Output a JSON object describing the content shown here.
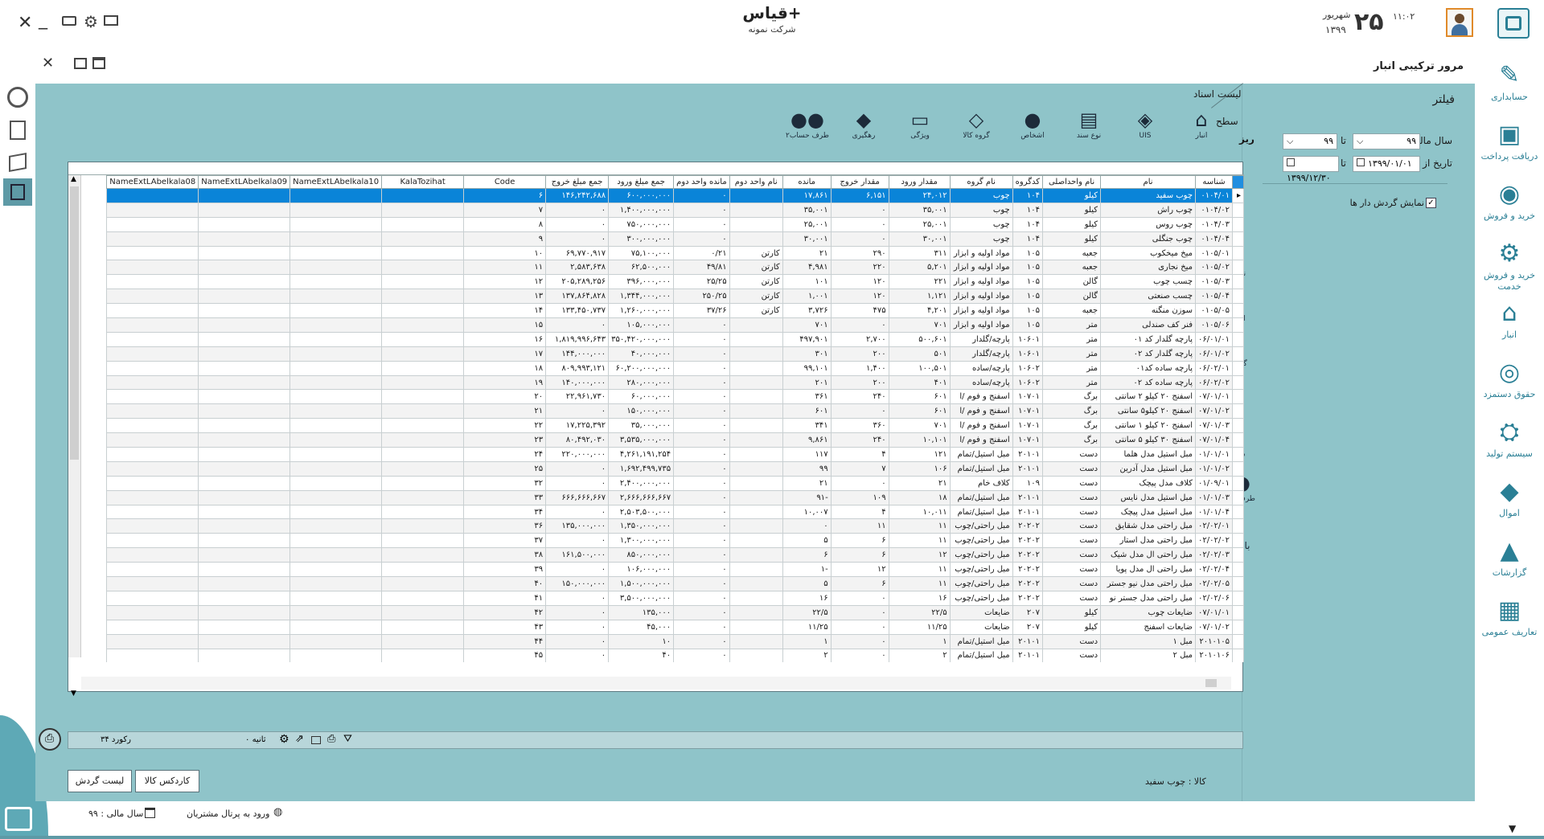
{
  "header": {
    "app_title": "قیاس+",
    "company": "شرکت نمونه",
    "time": "۱۱:۰۲",
    "day": "۲۵",
    "month": "شهریور",
    "year": "۱۳۹۹"
  },
  "window_controls": [
    "close-icon",
    "minimize-icon",
    "keyboard-icon",
    "gear-icon",
    "monitor-icon"
  ],
  "page_title": "مرور ترکیبی انبار",
  "nav": [
    {
      "label": "حسابداری",
      "icon": "accounting-icon"
    },
    {
      "label": "دریافت پرداخت",
      "icon": "payment-icon"
    },
    {
      "label": "خرید و فروش",
      "icon": "cart-icon"
    },
    {
      "label": "خرید و فروش خدمت",
      "icon": "service-gear-icon"
    },
    {
      "label": "انبار",
      "icon": "warehouse-icon"
    },
    {
      "label": "حقوق دستمزد",
      "icon": "coins-icon"
    },
    {
      "label": "سیستم تولید",
      "icon": "production-icon"
    },
    {
      "label": "اموال",
      "icon": "box-icon"
    },
    {
      "label": "گزارشات",
      "icon": "chart-icon"
    },
    {
      "label": "تعاریف عمومی",
      "icon": "table-icon"
    }
  ],
  "filter": {
    "title": "فیلتر",
    "fiscal_from_label": "سال مالی از",
    "fiscal_from": "۹۹",
    "to_label": "تا",
    "fiscal_to": "۹۹",
    "date_from_label": "تاریخ از",
    "date_from": "۱۳۹۹/۰۱/۰۱",
    "date_to": "۱۳۹۹/۱۲/۳۰",
    "show_active_label": "نمایش گردش دار ها"
  },
  "docs_list_title": "لیست اسناد",
  "level": {
    "top": "سطح",
    "sub": "ریز"
  },
  "toolbar": [
    {
      "label": "انبار",
      "icon": "warehouse-icon"
    },
    {
      "label": "UIS",
      "icon": "cube-icon"
    },
    {
      "label": "نوع سند",
      "icon": "doc-type-icon"
    },
    {
      "label": "اشخاص",
      "icon": "person-icon"
    },
    {
      "label": "گروه کالا",
      "icon": "group-icon"
    },
    {
      "label": "ویژگی",
      "icon": "feature-icon"
    },
    {
      "label": "رهگیری",
      "icon": "tag-icon"
    },
    {
      "label": "طرف حساب۲",
      "icon": "people-icon"
    }
  ],
  "side_tools": [
    {
      "label": "انبار",
      "icon": "warehouse-icon"
    },
    {
      "label": "UIS",
      "icon": "cube-icon"
    },
    {
      "label": "نوع سند",
      "icon": "doc-type-icon"
    },
    {
      "label": "اشخاص",
      "icon": "person-icon"
    },
    {
      "label": "گروه کالا",
      "icon": "group-icon"
    },
    {
      "label": "ویژگی",
      "icon": "feature-icon"
    },
    {
      "label": "رهگیری",
      "icon": "tag-icon"
    },
    {
      "label": "طرف حساب۲",
      "icon": "people-icon"
    },
    {
      "label": "بازگشت",
      "icon": "back-icon"
    }
  ],
  "columns": [
    "شناسه",
    "نام",
    "نام واحداصلی",
    "کدگروه",
    "نام گروه",
    "مقدار ورود",
    "مقدار خروج",
    "مانده",
    "نام واحد دوم",
    "مانده واحد دوم",
    "جمع مبلغ ورود",
    "جمع مبلغ خروج",
    "Code",
    "KalaTozihat",
    "NameExtLAbelkala10",
    "NameExtLAbelkala09",
    "NameExtLAbelkala08"
  ],
  "rows": [
    [
      "۰۱۰۴/۰۱",
      "چوب سفید",
      "کیلو",
      "۱۰۴",
      "چوب",
      "۲۴,۰۱۲",
      "۶,۱۵۱",
      "۱۷,۸۶۱",
      "",
      "۰",
      "۶۰۰,۰۰۰,۰۰۰",
      "۱۴۶,۲۴۲,۶۸۸",
      "۶",
      "",
      "",
      "",
      ""
    ],
    [
      "۰۱۰۴/۰۲",
      "چوب راش",
      "کیلو",
      "۱۰۴",
      "چوب",
      "۳۵,۰۰۱",
      "۰",
      "۳۵,۰۰۱",
      "",
      "۰",
      "۱,۴۰۰,۰۰۰,۰۰۰",
      "۰",
      "۷",
      "",
      "",
      "",
      ""
    ],
    [
      "۰۱۰۴/۰۳",
      "چوب روس",
      "کیلو",
      "۱۰۴",
      "چوب",
      "۲۵,۰۰۱",
      "۰",
      "۲۵,۰۰۱",
      "",
      "۰",
      "۷۵۰,۰۰۰,۰۰۰",
      "۰",
      "۸",
      "",
      "",
      "",
      ""
    ],
    [
      "۰۱۰۴/۰۴",
      "چوب جنگلی",
      "کیلو",
      "۱۰۴",
      "چوب",
      "۳۰,۰۰۱",
      "۰",
      "۳۰,۰۰۱",
      "",
      "۰",
      "۳۰۰,۰۰۰,۰۰۰",
      "۰",
      "۹",
      "",
      "",
      "",
      ""
    ],
    [
      "۰۱۰۵/۰۱",
      "میخ میخکوب",
      "جعبه",
      "۱۰۵",
      "مواد اولیه و ابزار",
      "۳۱۱",
      "۲۹۰",
      "۲۱",
      "کارتن",
      "۰/۲۱",
      "۷۵,۱۰۰,۰۰۰",
      "۶۹,۷۷۰,۹۱۷",
      "۱۰",
      "",
      "",
      "",
      ""
    ],
    [
      "۰۱۰۵/۰۲",
      "میخ نجاری",
      "جعبه",
      "۱۰۵",
      "مواد اولیه و ابزار",
      "۵,۲۰۱",
      "۲۲۰",
      "۴,۹۸۱",
      "کارتن",
      "۴۹/۸۱",
      "۶۲,۵۰۰,۰۰۰",
      "۲,۵۸۳,۶۳۸",
      "۱۱",
      "",
      "",
      "",
      ""
    ],
    [
      "۰۱۰۵/۰۳",
      "چسب چوب",
      "گالن",
      "۱۰۵",
      "مواد اولیه و ابزار",
      "۲۲۱",
      "۱۲۰",
      "۱۰۱",
      "کارتن",
      "۲۵/۲۵",
      "۳۹۶,۰۰۰,۰۰۰",
      "۲۰۵,۲۸۹,۲۵۶",
      "۱۲",
      "",
      "",
      "",
      ""
    ],
    [
      "۰۱۰۵/۰۴",
      "چسب صنعتی",
      "گالن",
      "۱۰۵",
      "مواد اولیه و ابزار",
      "۱,۱۲۱",
      "۱۲۰",
      "۱,۰۰۱",
      "کارتن",
      "۲۵۰/۲۵",
      "۱,۳۴۴,۰۰۰,۰۰۰",
      "۱۳۷,۸۶۴,۸۲۸",
      "۱۳",
      "",
      "",
      "",
      ""
    ],
    [
      "۰۱۰۵/۰۵",
      "سوزن منگنه",
      "جعبه",
      "۱۰۵",
      "مواد اولیه و ابزار",
      "۴,۲۰۱",
      "۴۷۵",
      "۳,۷۲۶",
      "کارتن",
      "۳۷/۲۶",
      "۱,۲۶۰,۰۰۰,۰۰۰",
      "۱۳۳,۴۵۰,۷۳۷",
      "۱۴",
      "",
      "",
      "",
      ""
    ],
    [
      "۰۱۰۵/۰۶",
      "فنر کف صندلی",
      "متر",
      "۱۰۵",
      "مواد اولیه و ابزار",
      "۷۰۱",
      "۰",
      "۷۰۱",
      "",
      "۰",
      "۱۰۵,۰۰۰,۰۰۰",
      "۰",
      "۱۵",
      "",
      "",
      "",
      ""
    ],
    [
      "۰۶/۰۱/۰۱",
      "پارچه گلدار کد ۰۱",
      "متر",
      "۱۰۶۰۱",
      "پارچه/گلدار",
      "۵۰۰,۶۰۱",
      "۲,۷۰۰",
      "۴۹۷,۹۰۱",
      "",
      "۰",
      "۳۵۰,۴۲۰,۰۰۰,۰۰۰",
      "۱,۸۱۹,۹۹۶,۶۴۳",
      "۱۶",
      "",
      "",
      "",
      ""
    ],
    [
      "۰۶/۰۱/۰۲",
      "پارچه گلدار کد ۰۲",
      "متر",
      "۱۰۶۰۱",
      "پارچه/گلدار",
      "۵۰۱",
      "۲۰۰",
      "۳۰۱",
      "",
      "۰",
      "۴۰,۰۰۰,۰۰۰",
      "۱۴۴,۰۰۰,۰۰۰",
      "۱۷",
      "",
      "",
      "",
      ""
    ],
    [
      "۰۶/۰۲/۰۱",
      "پارچه ساده کد۰۱",
      "متر",
      "۱۰۶۰۲",
      "پارچه/ساده",
      "۱۰۰,۵۰۱",
      "۱,۴۰۰",
      "۹۹,۱۰۱",
      "",
      "۰",
      "۶۰,۲۰۰,۰۰۰,۰۰۰",
      "۸۰۹,۹۹۳,۱۲۱",
      "۱۸",
      "",
      "",
      "",
      ""
    ],
    [
      "۰۶/۰۲/۰۲",
      "پارچه ساده کد ۰۲",
      "متر",
      "۱۰۶۰۲",
      "پارچه/ساده",
      "۴۰۱",
      "۲۰۰",
      "۲۰۱",
      "",
      "۰",
      "۲۸۰,۰۰۰,۰۰۰",
      "۱۴۰,۰۰۰,۰۰۰",
      "۱۹",
      "",
      "",
      "",
      ""
    ],
    [
      "۰۷/۰۱/۰۱",
      "اسفنج ۲۰ کیلو ۲ سانتی",
      "برگ",
      "۱۰۷۰۱",
      "اسفنج و فوم /ا",
      "۶۰۱",
      "۲۴۰",
      "۳۶۱",
      "",
      "۰",
      "۶۰,۰۰۰,۰۰۰",
      "۲۲,۹۶۱,۷۳۰",
      "۲۰",
      "",
      "",
      "",
      ""
    ],
    [
      "۰۷/۰۱/۰۲",
      "اسفنج ۲۰ کیلو۵ سانتی",
      "برگ",
      "۱۰۷۰۱",
      "اسفنج و فوم /ا",
      "۶۰۱",
      "۰",
      "۶۰۱",
      "",
      "۰",
      "۱۵۰,۰۰۰,۰۰۰",
      "۰",
      "۲۱",
      "",
      "",
      "",
      ""
    ],
    [
      "۰۷/۰۱/۰۳",
      "اسفنج ۲۰ کیلو ۱ سانتی",
      "برگ",
      "۱۰۷۰۱",
      "اسفنج و فوم /ا",
      "۷۰۱",
      "۳۶۰",
      "۳۴۱",
      "",
      "۰",
      "۳۵,۰۰۰,۰۰۰",
      "۱۷,۲۲۵,۳۹۲",
      "۲۲",
      "",
      "",
      "",
      ""
    ],
    [
      "۰۷/۰۱/۰۴",
      "اسفنج ۳۰ کیلو ۵ سانتی",
      "برگ",
      "۱۰۷۰۱",
      "اسفنج و فوم /ا",
      "۱۰,۱۰۱",
      "۲۴۰",
      "۹,۸۶۱",
      "",
      "۰",
      "۳,۵۳۵,۰۰۰,۰۰۰",
      "۸۰,۴۹۲,۰۳۰",
      "۲۳",
      "",
      "",
      "",
      ""
    ],
    [
      "۰۱/۰۱/۰۱",
      "مبل استیل مدل هلما",
      "دست",
      "۲۰۱۰۱",
      "مبل استیل/تمام",
      "۱۲۱",
      "۴",
      "۱۱۷",
      "",
      "۰",
      "۴,۲۶۱,۱۹۱,۲۵۴",
      "۲۲۰,۰۰۰,۰۰۰",
      "۲۴",
      "",
      "",
      "",
      ""
    ],
    [
      "۰۱/۰۱/۰۲",
      "مبل استیل مدل آدرین",
      "دست",
      "۲۰۱۰۱",
      "مبل استیل/تمام",
      "۱۰۶",
      "۷",
      "۹۹",
      "",
      "۰",
      "۱,۶۹۲,۴۹۹,۷۳۵",
      "۰",
      "۲۵",
      "",
      "",
      "",
      ""
    ],
    [
      "۰۱/۰۹/۰۱",
      "کلاف مدل پیچک",
      "دست",
      "۱۰۹",
      "کلاف خام",
      "۲۱",
      "۰",
      "۲۱",
      "",
      "۰",
      "۲,۴۰۰,۰۰۰,۰۰۰",
      "۰",
      "۳۲",
      "",
      "",
      "",
      ""
    ],
    [
      "۰۱/۰۱/۰۳",
      "مبل استیل مدل نایس",
      "دست",
      "۲۰۱۰۱",
      "مبل استیل/تمام",
      "۱۸",
      "۱۰۹",
      "-۹۱",
      "",
      "۰",
      "۲,۶۶۶,۶۶۶,۶۶۷",
      "۶۶۶,۶۶۶,۶۶۷",
      "۳۳",
      "",
      "",
      "",
      ""
    ],
    [
      "۰۱/۰۱/۰۴",
      "مبل استیل مدل پیچک",
      "دست",
      "۲۰۱۰۱",
      "مبل استیل/تمام",
      "۱۰,۰۱۱",
      "۴",
      "۱۰,۰۰۷",
      "",
      "۰",
      "۲,۵۰۳,۵۰۰,۰۰۰",
      "۰",
      "۳۴",
      "",
      "",
      "",
      ""
    ],
    [
      "۰۲/۰۲/۰۱",
      "مبل راحتی مدل شقایق",
      "دست",
      "۲۰۲۰۲",
      "مبل راحتی/چوب",
      "۱۱",
      "۱۱",
      "۰",
      "",
      "۰",
      "۱,۳۵۰,۰۰۰,۰۰۰",
      "۱۳۵,۰۰۰,۰۰۰",
      "۳۶",
      "",
      "",
      "",
      ""
    ],
    [
      "۰۲/۰۲/۰۲",
      "مبل راحتی مدل استار",
      "دست",
      "۲۰۲۰۲",
      "مبل راحتی/چوب",
      "۱۱",
      "۶",
      "۵",
      "",
      "۰",
      "۱,۳۰۰,۰۰۰,۰۰۰",
      "۰",
      "۳۷",
      "",
      "",
      "",
      ""
    ],
    [
      "۰۲/۰۲/۰۳",
      "مبل راحتی ال مدل شیک",
      "دست",
      "۲۰۲۰۲",
      "مبل راحتی/چوب",
      "۱۲",
      "۶",
      "۶",
      "",
      "۰",
      "۸۵۰,۰۰۰,۰۰۰",
      "۱۶۱,۵۰۰,۰۰۰",
      "۳۸",
      "",
      "",
      "",
      ""
    ],
    [
      "۰۲/۰۲/۰۴",
      "مبل راحتی ال مدل پویا",
      "دست",
      "۲۰۲۰۲",
      "مبل راحتی/چوب",
      "۱۱",
      "۱۲",
      "-۱",
      "",
      "۰",
      "۱۰۶,۰۰۰,۰۰۰",
      "۰",
      "۳۹",
      "",
      "",
      "",
      ""
    ],
    [
      "۰۲/۰۲/۰۵",
      "مبل راحتی مدل نیو جستر",
      "دست",
      "۲۰۲۰۲",
      "مبل راحتی/چوب",
      "۱۱",
      "۶",
      "۵",
      "",
      "۰",
      "۱,۵۰۰,۰۰۰,۰۰۰",
      "۱۵۰,۰۰۰,۰۰۰",
      "۴۰",
      "",
      "",
      "",
      ""
    ],
    [
      "۰۲/۰۲/۰۶",
      "مبل راحتی مدل جستر نو",
      "دست",
      "۲۰۲۰۲",
      "مبل راحتی/چوب",
      "۱۶",
      "۰",
      "۱۶",
      "",
      "۰",
      "۳,۵۰۰,۰۰۰,۰۰۰",
      "۰",
      "۴۱",
      "",
      "",
      "",
      ""
    ],
    [
      "۰۷/۰۱/۰۱",
      "ضایعات چوب",
      "کیلو",
      "۲۰۷",
      "ضایعات",
      "۲۲/۵",
      "۰",
      "۲۲/۵",
      "",
      "۰",
      "۱۳۵,۰۰۰",
      "۰",
      "۴۲",
      "",
      "",
      "",
      ""
    ],
    [
      "۰۷/۰۱/۰۲",
      "ضایعات اسفنج",
      "کیلو",
      "۲۰۷",
      "ضایعات",
      "۱۱/۲۵",
      "۰",
      "۱۱/۲۵",
      "",
      "۰",
      "۴۵,۰۰۰",
      "۰",
      "۴۳",
      "",
      "",
      "",
      ""
    ],
    [
      "۲۰۱۰۱۰۵",
      "مبل ۱",
      "دست",
      "۲۰۱۰۱",
      "مبل استیل/تمام",
      "۱",
      "۰",
      "۱",
      "",
      "۰",
      "۱۰",
      "۰",
      "۴۴",
      "",
      "",
      "",
      ""
    ],
    [
      "۲۰۱۰۱۰۶",
      "مبل ۲",
      "دست",
      "۲۰۱۰۱",
      "مبل استیل/تمام",
      "۲",
      "۰",
      "۲",
      "",
      "۰",
      "۴۰",
      "۰",
      "۴۵",
      "",
      "",
      "",
      ""
    ],
    [
      "۲۰۱۰۱۰۸",
      "لبنیات",
      "دست",
      "۲۰۲۰۲",
      "مبل راحتی/چوب",
      "۱",
      "۰",
      "۱",
      "",
      "۰",
      "۱,۰۰۰",
      "۰",
      "۴۷",
      "",
      "",
      "",
      ""
    ]
  ],
  "status": {
    "record_count": "۳۴ رکورد",
    "seconds": "۰ ثانیه"
  },
  "buttons": {
    "turnover_list": "لیست گردش",
    "kardex": "کاردکس کالا"
  },
  "selected_item": "کالا : چوب سفید",
  "footer": {
    "fiscal_year": "سال مالی : ۹۹",
    "portal": "ورود به پرتال مشتریان"
  }
}
